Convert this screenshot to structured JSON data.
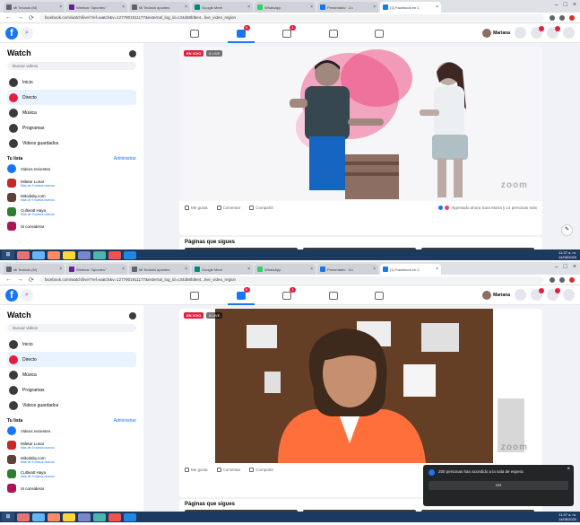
{
  "browser_tabs": [
    {
      "label": "Mi Teclado (M)",
      "color": "#5f6368",
      "active": false
    },
    {
      "label": "Webinar \"Apuntes\"",
      "color": "#6a1b9a",
      "active": false
    },
    {
      "label": "Mi Teclado apuntes",
      "color": "#5f6368",
      "active": false
    },
    {
      "label": "Google Meet",
      "color": "#00897b",
      "active": false
    },
    {
      "label": "WhatsApp",
      "color": "#25d366",
      "active": false
    },
    {
      "label": "Presentarlo · Zo",
      "color": "#1a73e8",
      "active": false
    },
    {
      "label": "(1) Facebook en C",
      "color": "#1877f2",
      "active": true
    }
  ],
  "url": "facebook.com/watch/live/?ref=watch&v=1277901911177&external_log_id=c34d68fd6e4...live_video_region",
  "header": {
    "profile_name": "Mariana",
    "nav_badges": [
      "9",
      "",
      "1",
      "",
      ""
    ]
  },
  "sidebar": {
    "title": "Watch",
    "search_placeholder": "Buscar videos",
    "menu": [
      {
        "label": "Inicio",
        "icon": "home-icon"
      },
      {
        "label": "Directo",
        "icon": "live-icon"
      },
      {
        "label": "Música",
        "icon": "music-icon"
      },
      {
        "label": "Programas",
        "icon": "shows-icon"
      },
      {
        "label": "Videos guardados",
        "icon": "saved-icon"
      }
    ],
    "following_heading": "Tu lista",
    "following_link": "Administrar",
    "following": [
      {
        "name": "Videos recientes",
        "sub": ""
      },
      {
        "name": "Miletar Lunar",
        "sub": "Más de 9 videos nuevos"
      },
      {
        "name": "Mitodaby.com",
        "sub": "Más de 9 videos nuevos"
      },
      {
        "name": "Cultivatt Haya",
        "sub": "Más de 9 videos nuevos"
      },
      {
        "name": "Si considerar",
        "sub": ""
      }
    ]
  },
  "video": {
    "live_label": "EN VIVO",
    "viewers_label": "8 LIVE",
    "watermark": "zoom"
  },
  "actions": {
    "like": "Me gusta",
    "comment": "Comentar",
    "share": "Compartir",
    "reactions_text": "Ingresado ahora Sara María y 14 personas más"
  },
  "paginas_heading": "Páginas que sigues",
  "notification": {
    "text": "200 personas han accedido a la sala de espera",
    "button": "Ver"
  },
  "taskbar": {
    "start": "⊞",
    "apps": [
      "#e57373",
      "#64b5f6",
      "#ff8a65",
      "#fdd835",
      "#7986cb",
      "#4db6ac",
      "#ef5350",
      "#1e88e5"
    ],
    "time": "11:37 a. m.",
    "date": "14/08/2020"
  }
}
